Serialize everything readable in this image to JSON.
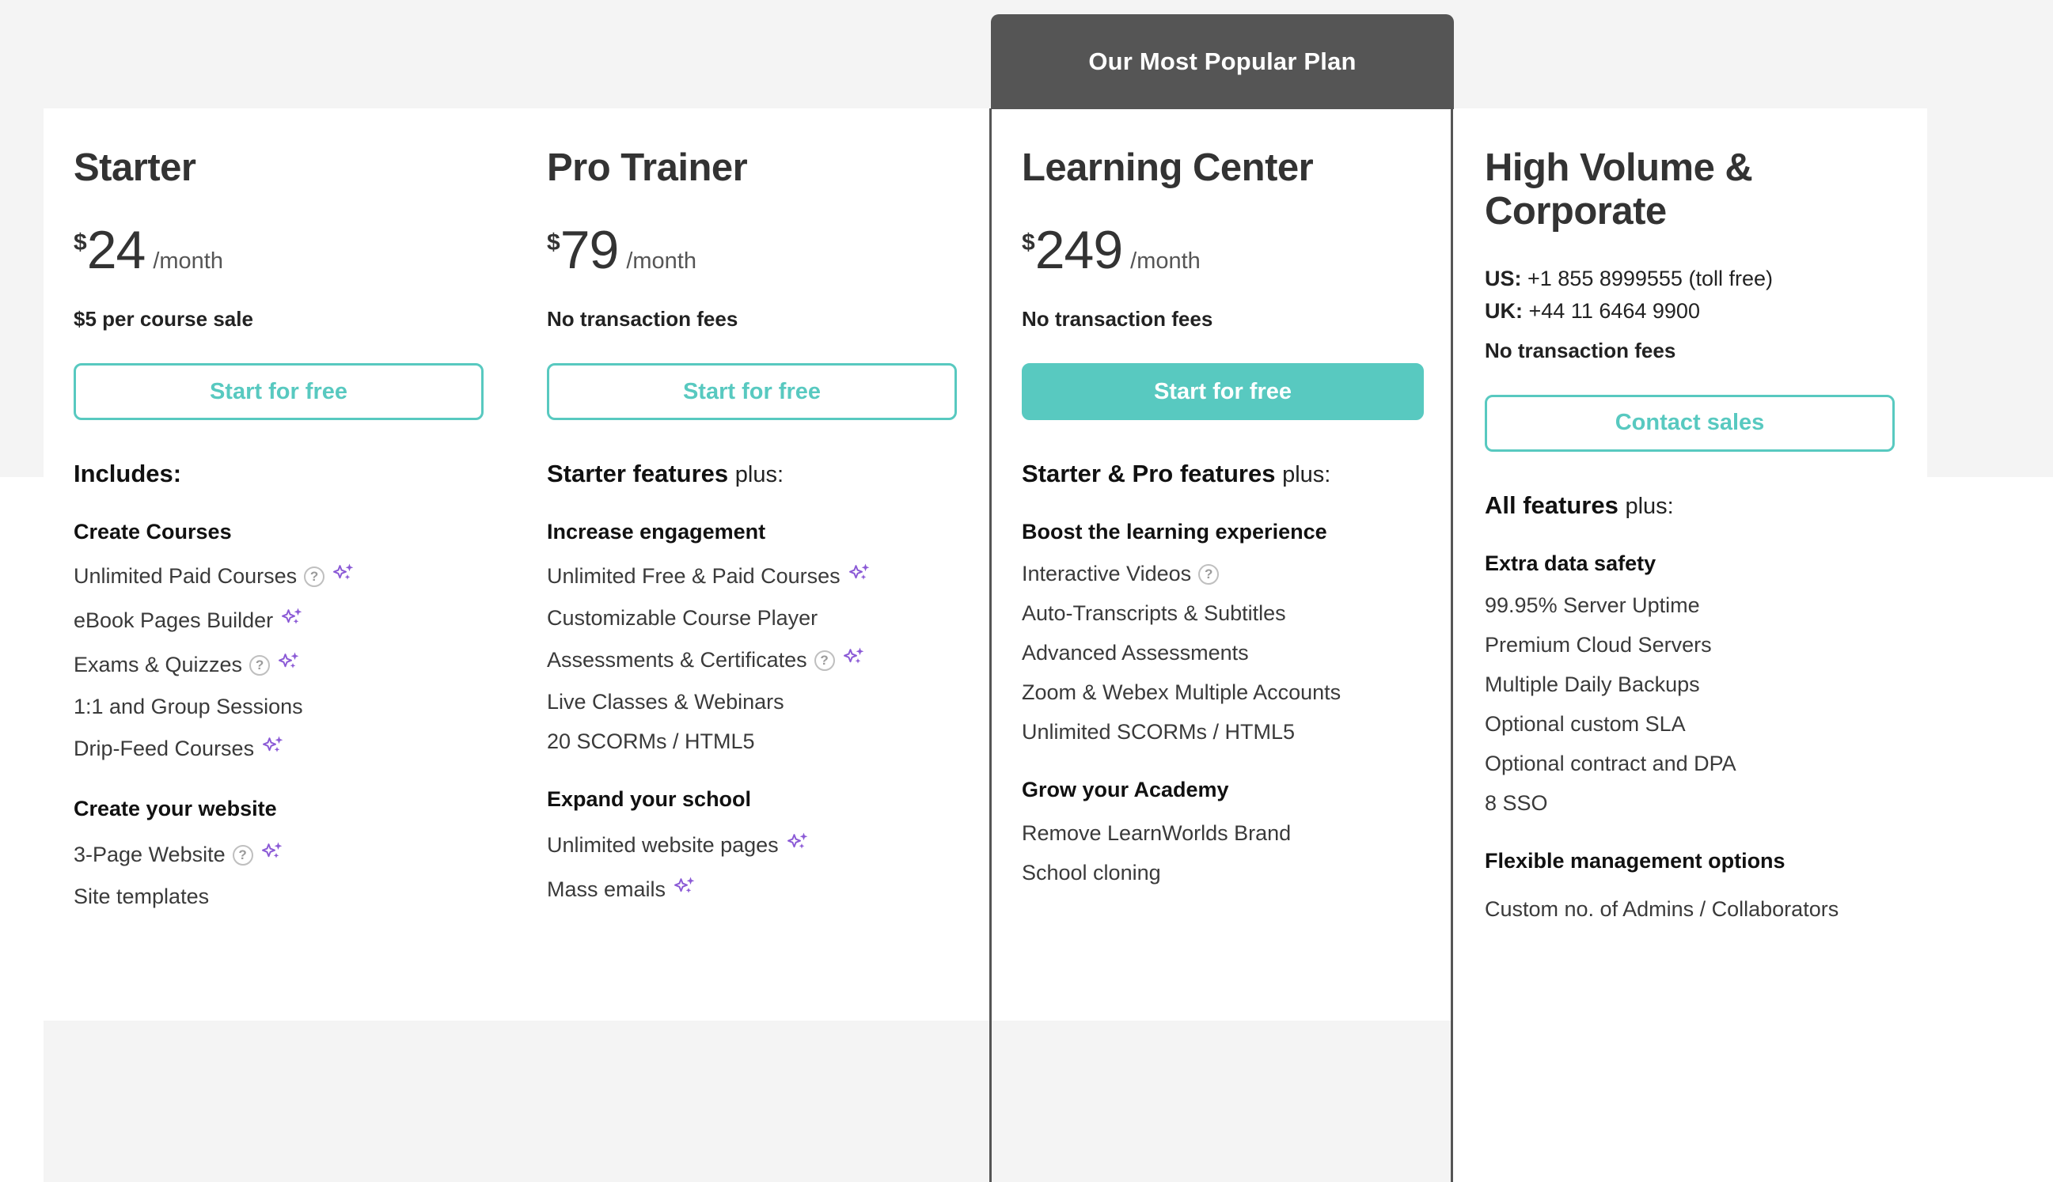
{
  "banner": {
    "label": "Our Most Popular Plan"
  },
  "colors": {
    "accent": "#58c9c0",
    "banner_bg": "#555555",
    "sparkle": "#8b5ad6",
    "section_bg": "#f4f4f4"
  },
  "icons": {
    "help": "?",
    "ai_sparkle": "sparkle-icon"
  },
  "plans": [
    {
      "name": "Starter",
      "currency": "$",
      "amount": "24",
      "period": "/month",
      "fee_note": "$5 per course sale",
      "cta": {
        "label": "Start for free",
        "style": "outline"
      },
      "section_head_bold": "Includes:",
      "section_head_plus": "",
      "groups": [
        {
          "title": "Create Courses",
          "features": [
            {
              "label": "Unlimited Paid Courses",
              "help": true,
              "ai": true
            },
            {
              "label": "eBook Pages Builder",
              "help": false,
              "ai": true
            },
            {
              "label": "Exams & Quizzes",
              "help": true,
              "ai": true
            },
            {
              "label": "1:1 and Group Sessions",
              "help": false,
              "ai": false
            },
            {
              "label": "Drip-Feed Courses",
              "help": false,
              "ai": true
            }
          ]
        }
      ],
      "bottom_group": {
        "title": "Create your website",
        "features": [
          {
            "label": "3-Page Website",
            "help": true,
            "ai": true
          },
          {
            "label": "Site templates",
            "help": false,
            "ai": false
          }
        ]
      }
    },
    {
      "name": "Pro Trainer",
      "currency": "$",
      "amount": "79",
      "period": "/month",
      "fee_note": "No transaction fees",
      "cta": {
        "label": "Start for free",
        "style": "outline"
      },
      "section_head_bold": "Starter features",
      "section_head_plus": "plus:",
      "groups": [
        {
          "title": "Increase engagement",
          "features": [
            {
              "label": "Unlimited Free & Paid Courses",
              "help": false,
              "ai": true
            },
            {
              "label": "Customizable Course Player",
              "help": false,
              "ai": false
            },
            {
              "label": "Assessments & Certificates",
              "help": true,
              "ai": true
            },
            {
              "label": "Live Classes & Webinars",
              "help": false,
              "ai": false
            },
            {
              "label": "20 SCORMs / HTML5",
              "help": false,
              "ai": false
            }
          ]
        }
      ],
      "bottom_group": {
        "title": "Expand your school",
        "features": [
          {
            "label": "Unlimited website pages",
            "help": false,
            "ai": true
          },
          {
            "label": "Mass emails",
            "help": false,
            "ai": true
          }
        ]
      }
    },
    {
      "name": "Learning Center",
      "currency": "$",
      "amount": "249",
      "period": "/month",
      "fee_note": "No transaction fees",
      "cta": {
        "label": "Start for free",
        "style": "filled"
      },
      "section_head_bold": "Starter & Pro features",
      "section_head_plus": "plus:",
      "groups": [
        {
          "title": "Boost the learning experience",
          "features": [
            {
              "label": "Interactive Videos",
              "help": true,
              "ai": false
            },
            {
              "label": "Auto-Transcripts & Subtitles",
              "help": false,
              "ai": false
            },
            {
              "label": "Advanced Assessments",
              "help": false,
              "ai": false
            },
            {
              "label": "Zoom & Webex Multiple Accounts",
              "help": false,
              "ai": false
            },
            {
              "label": "Unlimited SCORMs / HTML5",
              "help": false,
              "ai": false
            }
          ]
        }
      ],
      "bottom_group": {
        "title": "Grow your Academy",
        "features": [
          {
            "label": "Remove LearnWorlds Brand",
            "help": false,
            "ai": false
          },
          {
            "label": "School cloning",
            "help": false,
            "ai": false
          }
        ]
      }
    },
    {
      "name": "High Volume & Corporate",
      "currency": "",
      "amount": "",
      "period": "",
      "phone_us_label": "US:",
      "phone_us_value": "+1 855 8999555 (toll free)",
      "phone_uk_label": "UK:",
      "phone_uk_value": "+44 11 6464 9900",
      "fee_note": "No transaction fees",
      "cta": {
        "label": "Contact sales",
        "style": "outline"
      },
      "section_head_bold": "All features",
      "section_head_plus": "plus:",
      "groups": [
        {
          "title": "Extra data safety",
          "features": [
            {
              "label": "99.95% Server Uptime",
              "help": false,
              "ai": false
            },
            {
              "label": "Premium Cloud Servers",
              "help": false,
              "ai": false
            },
            {
              "label": "Multiple Daily Backups",
              "help": false,
              "ai": false
            },
            {
              "label": "Optional custom SLA",
              "help": false,
              "ai": false
            },
            {
              "label": "Optional contract and DPA",
              "help": false,
              "ai": false
            },
            {
              "label": "8 SSO",
              "help": false,
              "ai": false
            }
          ]
        }
      ],
      "bottom_group": {
        "title": "Flexible management options",
        "features": [
          {
            "label": "Custom no. of Admins / Collaborators",
            "help": false,
            "ai": false,
            "wrap": true
          }
        ]
      }
    }
  ]
}
